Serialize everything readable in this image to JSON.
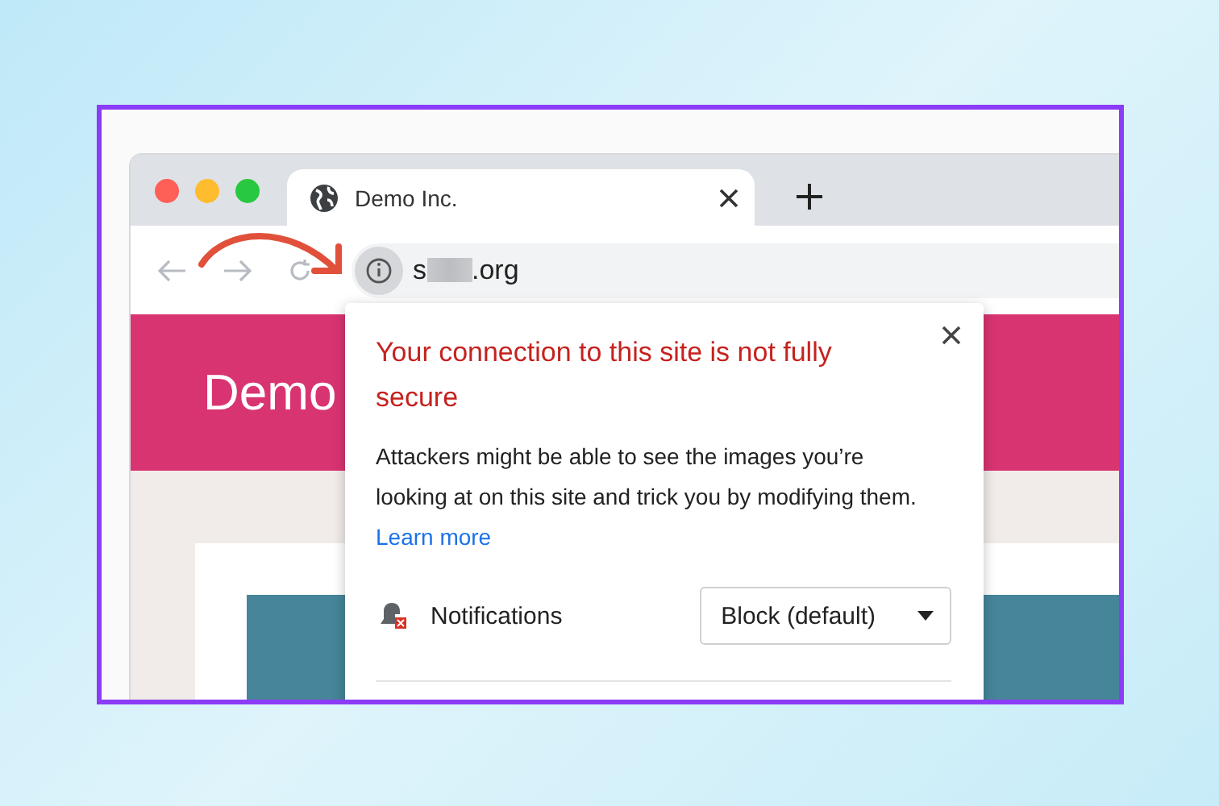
{
  "tabs": [
    {
      "title": "Demo Inc.",
      "selected": true
    }
  ],
  "address_bar": {
    "url_start": "s",
    "url_end": ".org"
  },
  "page": {
    "header_title": "Demo"
  },
  "site_info_popup": {
    "title": "Your connection to this site is not fully secure",
    "message": "Attackers might be able to see the images you’re looking at on this site and trick you by modifying them.",
    "link": "Learn more",
    "permissions": [
      {
        "label": "Notifications",
        "value": "Block (default)"
      }
    ]
  }
}
